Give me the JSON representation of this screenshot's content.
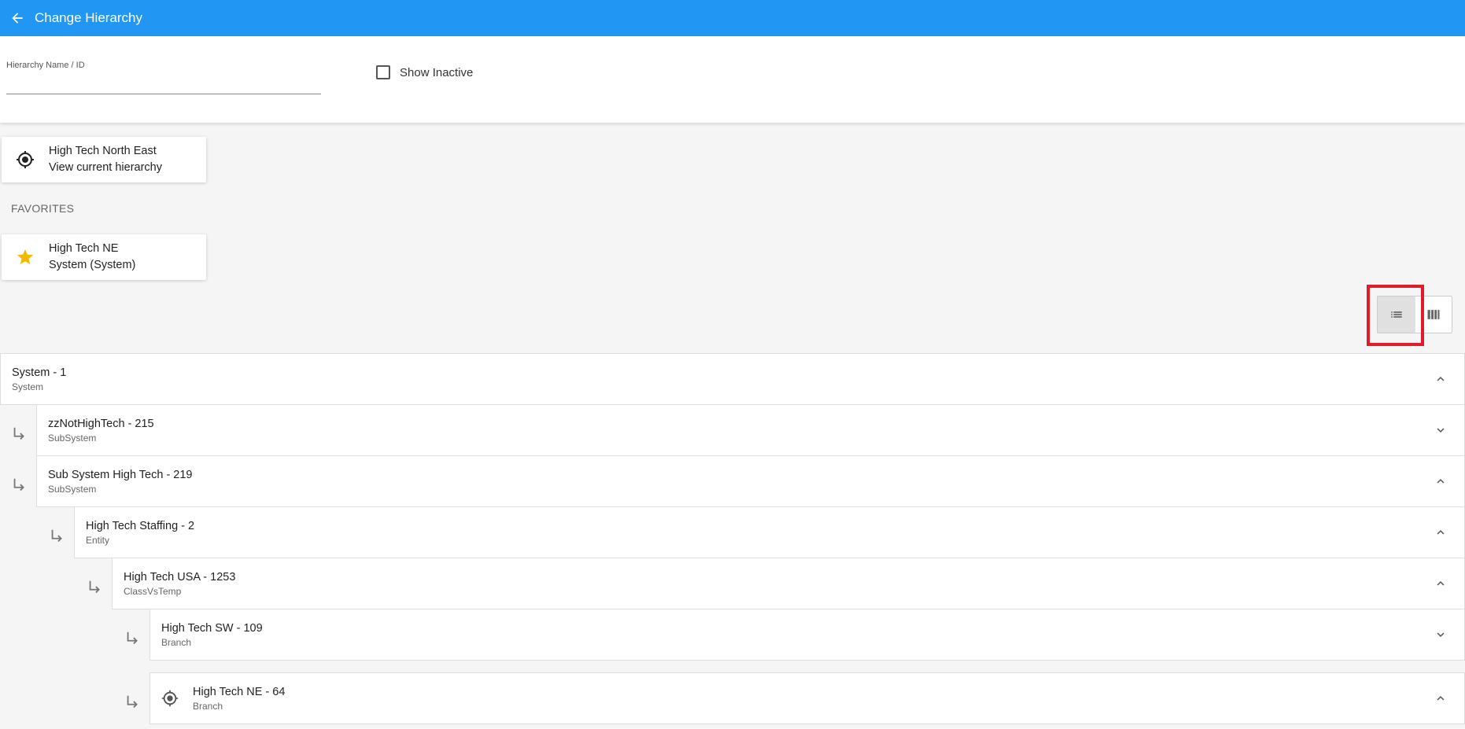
{
  "header": {
    "title": "Change Hierarchy"
  },
  "search": {
    "field_label": "Hierarchy Name / ID",
    "value": "",
    "show_inactive_label": "Show Inactive"
  },
  "current": {
    "name": "High Tech North East",
    "subtitle": "View current hierarchy"
  },
  "favorites": {
    "header": "FAVORITES",
    "items": [
      {
        "name": "High Tech NE",
        "subtitle": "System (System)"
      }
    ]
  },
  "tree": {
    "rows": [
      {
        "name": "System - 1",
        "type": "System",
        "expanded": true
      },
      {
        "name": "zzNotHighTech - 215",
        "type": "SubSystem",
        "expanded": false
      },
      {
        "name": "Sub System High Tech - 219",
        "type": "SubSystem",
        "expanded": true
      },
      {
        "name": "High Tech Staffing - 2",
        "type": "Entity",
        "expanded": true
      },
      {
        "name": "High Tech USA - 1253",
        "type": "ClassVsTemp",
        "expanded": true
      },
      {
        "name": "High Tech SW - 109",
        "type": "Branch",
        "expanded": false
      },
      {
        "name": "High Tech NE - 64",
        "type": "Branch",
        "expanded": true
      }
    ]
  }
}
